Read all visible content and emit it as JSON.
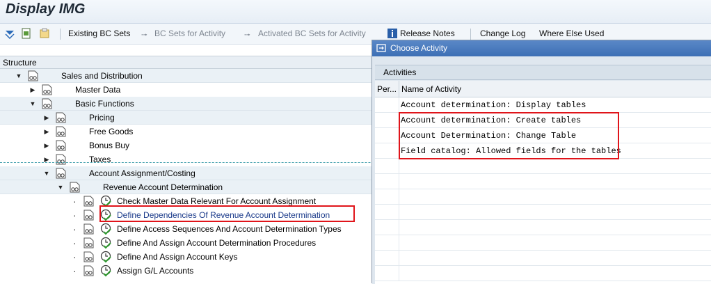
{
  "window": {
    "title": "Display IMG"
  },
  "toolbar": {
    "existing_bc_sets": "Existing BC Sets",
    "bc_sets_for_activity": "BC Sets for Activity",
    "activated_bc_sets": "Activated BC Sets for Activity",
    "release_notes": "Release Notes",
    "change_log": "Change Log",
    "where_else_used": "Where Else Used"
  },
  "tree": {
    "header": "Structure",
    "rows": [
      {
        "label": "Sales and Distribution",
        "expanded": true
      },
      {
        "label": "Master Data",
        "expanded": false
      },
      {
        "label": "Basic Functions",
        "expanded": true
      },
      {
        "label": "Pricing",
        "expanded": false
      },
      {
        "label": "Free Goods",
        "expanded": false
      },
      {
        "label": "Bonus Buy",
        "expanded": false
      },
      {
        "label": "Taxes",
        "expanded": false
      },
      {
        "label": "Account Assignment/Costing",
        "expanded": true
      },
      {
        "label": "Revenue Account Determination",
        "expanded": true
      },
      {
        "label": "Check Master Data Relevant For Account Assignment"
      },
      {
        "label": "Define Dependencies Of Revenue Account Determination",
        "highlighted": true
      },
      {
        "label": "Define Access Sequences And Account Determination Types"
      },
      {
        "label": "Define And Assign Account Determination Procedures"
      },
      {
        "label": "Define And Assign Account Keys"
      },
      {
        "label": "Assign G/L Accounts"
      }
    ]
  },
  "dialog": {
    "title": "Choose Activity",
    "section": "Activities",
    "columns": {
      "per": "Per...",
      "name": "Name of Activity"
    },
    "activities": [
      "Account determination: Display tables",
      "Account determination: Create tables",
      "Account Determination: Change Table",
      "Field catalog: Allowed fields for the tables"
    ]
  },
  "colors": {
    "highlight_box": "#e0141a",
    "dialog_title_bg": "#3d6fb5",
    "link_text": "#1a3a8a"
  }
}
